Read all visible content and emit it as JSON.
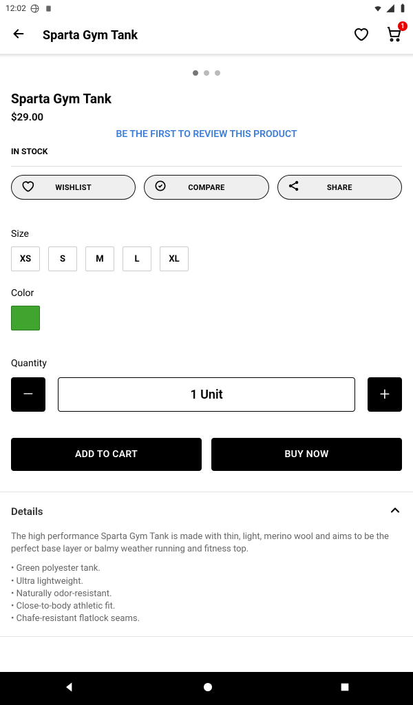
{
  "statusbar": {
    "time": "12:02"
  },
  "appbar": {
    "title": "Sparta Gym Tank",
    "cart_count": "1"
  },
  "product": {
    "title": "Sparta Gym Tank",
    "price": "$29.00",
    "review_link": "BE THE FIRST TO REVIEW THIS PRODUCT",
    "stock": "IN STOCK"
  },
  "actions": {
    "wishlist": "WISHLIST",
    "compare": "COMPARE",
    "share": "SHARE"
  },
  "size": {
    "label": "Size",
    "options": [
      "XS",
      "S",
      "M",
      "L",
      "XL"
    ]
  },
  "color": {
    "label": "Color",
    "swatches": [
      "#3fa52f"
    ]
  },
  "quantity": {
    "label": "Quantity",
    "display": "1 Unit",
    "minus": "–",
    "plus": "+"
  },
  "cta": {
    "add": "ADD TO CART",
    "buy": "BUY NOW"
  },
  "details": {
    "title": "Details",
    "description": "The high performance Sparta Gym Tank is made with thin, light, merino wool and aims to be the perfect base layer or balmy weather running and fitness top.",
    "bullets": [
      "• Green polyester tank.",
      "• Ultra lightweight.",
      "• Naturally odor-resistant.",
      "• Close-to-body athletic fit.",
      "• Chafe-resistant flatlock seams."
    ]
  }
}
